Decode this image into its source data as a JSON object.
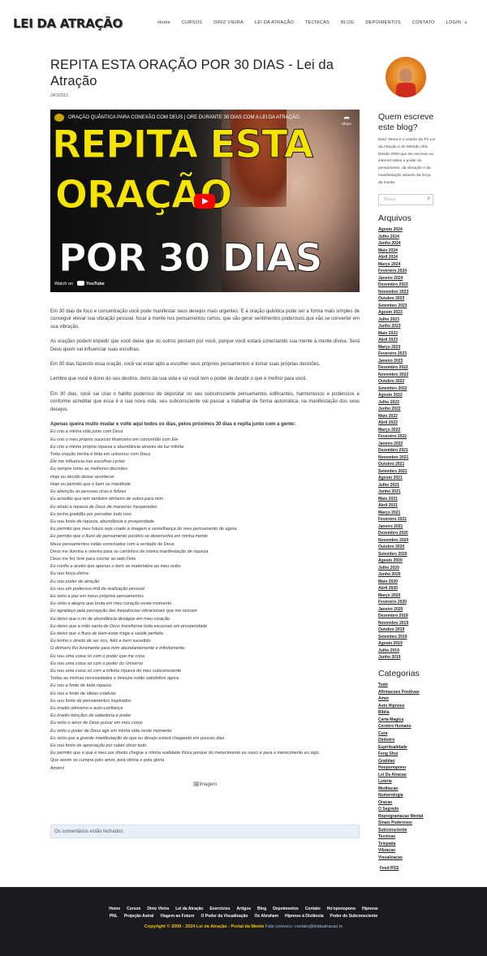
{
  "header": {
    "logo": "LEI DA ATRAÇÃO",
    "nav": [
      "Home",
      "CURSOS",
      "DINIZ VIEIRA",
      "LEI DA ATRAÇÃO",
      "TECNICAS",
      "BLOG",
      "DEPOIMENTOS",
      "CONTATO",
      "LOGIN"
    ],
    "search_icon": "search-icon"
  },
  "post": {
    "title": "REPITA ESTA ORAÇÃO POR 30 DIAS - Lei da Atração",
    "date": "24/3/2021",
    "video": {
      "caption": "ORAÇÃO QUÂNTICA PARA CONEXÃO COM DEUS | ORE DURANTE 30 DIAS COM A LEI DA ATRAÇÃO",
      "thumb_line1": "REPITA ESTA",
      "thumb_line2": "ORAÇÃO",
      "thumb_line3": "POR 30 DIAS",
      "share": "Share",
      "watch_on": "Watch on",
      "youtube": "YouTube"
    },
    "paragraphs": [
      "Em 30 dias de foco e concentração você pode manifestar seus desejos mais urgentes. E a oração quântica pode ser a forma mais simples de conseguir elevar sua vibração pessoal, focar a mente nos pensamentos certos, que vão gerar sentimentos poderosos que vão se converter em sua vibração.",
      "As orações podem impedir que você deixe que os outros pensem por você, porque você estará conectando sua mente à mente divina. Será Deus quem vai influenciar suas escolhas.",
      "Em 30 dias fazendo essa oração, você vai estar apto a escolher seus próprios pensamentos e tomar suas próprias decisões.",
      "Lembre que você é dono do seu destino, dono da sua vida e só você tem o poder de decidir o que é melhor para você.",
      "Em 30 dias, você vai criar o hábito poderoso de depositar no seu subconsciente pensamentos edificantes, harmoniosos e poderosos e conforme acreditar que essa é a sua nova vida, seu subconsciente vai passar a trabalhar de forma automática, na manifestação dos seus desejos."
    ],
    "prayer_intro": "Apenas queira muito mudar e volte aqui todos os dias, pelos próximos 30 dias e repita junto com a gente:",
    "prayer": [
      "Eu crio a minha vida junto com Deus",
      "Eu crio o meu próprio sucesso financeiro em comunhão com Ele",
      "Eu crio a minha própria riqueza e abundância através da luz infinita",
      "Toda criação minha é feita em unissono com Deus",
      "Ele me influencia nas escolhas certas",
      "Eu sempre tomo as melhores decisões",
      "Hoje eu decido deixar acontecer",
      "Hoje eu permito que o bem se manifeste",
      "Eu abençõo as pessoas ricas e felizes",
      "Eu acredito que tem também dinheiro de sobra para mim",
      "Eu atraio a riqueza de Deus de maneiras inesperadas",
      "Eu tenho gratidão por perceber tudo isso",
      "Eu sou fonte de riqueza, abundância e prosperidade",
      "Eu permito que meu futuro seja criado à imagem e semelhança do meu pensamento de agora",
      "Eu permito que o fluxo de pensamento positivo se desenvolva em minha mente",
      "Meus pensamentos estão conectados com a verdade de Deus",
      "Deus me ilumina e orienta para os caminhos de inteira manifestação de riqueza",
      "Deus me fez livre para cocriar ao lado Dele",
      "Eu confio e aceito que apenas o bem se materialize ao meu redor.",
      "Eu sou força divina",
      "Eu sou poder de atração",
      "Eu sou um poderoso imã de realização pessoal",
      "Eu sinto a paz em meus próprios pensamentos",
      "Eu sinto a alegria que brota em meu coração neste momento",
      "Eu agradeço pela percepção das frequências vibracionais que me cercam",
      "Eu deixo que o rio de abundância deságüe em meu coração",
      "Eu deixo que a mão santa de Deus transforme toda escassez em prosperidade",
      "Eu deixo que o fluxo de bem-estar traga a saúde perfeita",
      "Eu tenho o direito de ser rico, feliz e bem sucedido",
      "O dinheiro flui livremente para mim abundantemente e infinitamente.",
      "Eu sou uma coisa só com o poder que me criou",
      "Eu sou uma coisa só com o poder do Universo",
      "Eu sou uma coisa só com a infinita riqueza do meu subconsciente",
      "Todas as minhas necessidades e desejos estão satisfeitos agora",
      "Eu sou a fonte de toda riqueza",
      "Eu sou a fonte de idéias criativas",
      "Eu sou fonte de pensamentos inspirados",
      "Eu irradio otimismo e auto-confiança",
      "Eu irradio bênçãos de sabedoria e poder",
      "Eu sinto o amor de Deus pulsar em meu corpo",
      "Eu sinto o poder de Deus agir em minha vida neste momento",
      "Eu sinto que a grande manifestação do que eu desejo estará chegando em poucos dias",
      "Eu sou fonte de apreciação por saber disso tudo",
      "Eu permito que o que é meu por direito chegue a minha realidade física porque do merecimento eu nasci e para o merecimento eu sigo.",
      "Que assim se cumpra pelo amor, pela vitória e pela glória",
      "Amém!"
    ],
    "image_alt": "Imagem",
    "comments_closed": "Os comentários estão fechados."
  },
  "sidebar": {
    "about_title": "Quem escreve este blog?",
    "about_text": "Diniz Vieira é o criador da TV Lei da Atração e do Método Alfa. Desde 2009 que ele escreve na internet sobre o poder do pensamento, da vibração e da manifestação através da força da mente.",
    "search_placeholder": "Busca",
    "archives_title": "Arquivos",
    "archives": [
      "Agosto 2024",
      "Julho 2024",
      "Junho 2024",
      "Maio 2024",
      "Abril 2024",
      "Março 2024",
      "Fevereiro 2024",
      "Janeiro 2024",
      "Dezembro 2023",
      "Novembro 2023",
      "Outubro 2023",
      "Setembro 2023",
      "Agosto 2023",
      "Julho 2023",
      "Junho 2023",
      "Maio 2023",
      "Abril 2023",
      "Março 2023",
      "Fevereiro 2023",
      "Janeiro 2023",
      "Dezembro 2022",
      "Novembro 2022",
      "Outubro 2022",
      "Setembro 2022",
      "Agosto 2022",
      "Julho 2022",
      "Junho 2022",
      "Maio 2022",
      "Abril 2022",
      "Março 2022",
      "Fevereiro 2022",
      "Janeiro 2022",
      "Dezembro 2021",
      "Novembro 2021",
      "Outubro 2021",
      "Setembro 2021",
      "Agosto 2021",
      "Julho 2021",
      "Junho 2021",
      "Maio 2021",
      "Abril 2021",
      "Março 2021",
      "Fevereiro 2021",
      "Janeiro 2021",
      "Dezembro 2020",
      "Novembro 2020",
      "Outubro 2020",
      "Setembro 2020",
      "Agosto 2020",
      "Julho 2020",
      "Junho 2020",
      "Maio 2020",
      "Abril 2020",
      "Março 2020",
      "Fevereiro 2020",
      "Janeiro 2020",
      "Dezembro 2019",
      "Novembro 2019",
      "Outubro 2019",
      "Setembro 2019",
      "Agosto 2019",
      "Julho 2019",
      "Junho 2019"
    ],
    "categories_title": "Categorias",
    "categories": [
      "Tudo",
      "Afirmacoes Positivas",
      "Amor",
      "Auto Hipnose",
      "Biblia",
      "Carta Magica",
      "Cerebro Humano",
      "Cura",
      "Dinheiro",
      "Espiritualidade",
      "Feng Shui",
      "Gratidao",
      "Hooponopono",
      "Lei Da Atracao",
      "Loteria",
      "Meditacao",
      "Numerologia",
      "Oracao",
      "O Segredo",
      "Reprogramacao Mental",
      "Sinais Poderosos",
      "Subconsciente",
      "Tecnicas",
      "Telepatia",
      "Vibracao",
      "Visualizacao"
    ],
    "feed": "Feed RSS"
  },
  "footer": {
    "nav_row1": [
      "Home",
      "Cursos",
      "Diniz Vieira",
      "Lei da Atração",
      "Exercícios",
      "Artigos",
      "Blog",
      "Depoimentos",
      "Contato",
      "Ho'oponopono",
      "Hipnose"
    ],
    "nav_row2": [
      "PNL",
      "Projeção Astral",
      "Viagem ao Futuro",
      "O Poder da Visualização",
      "Os Abraham",
      "Hipnose à Distância",
      "Poder do Subconsciente"
    ],
    "copyright": "Copyright © 2009 - 2024 Lei da Atração - Portal da Mente",
    "contact": "Fale conosco: contato@leidaatracao.tv"
  }
}
